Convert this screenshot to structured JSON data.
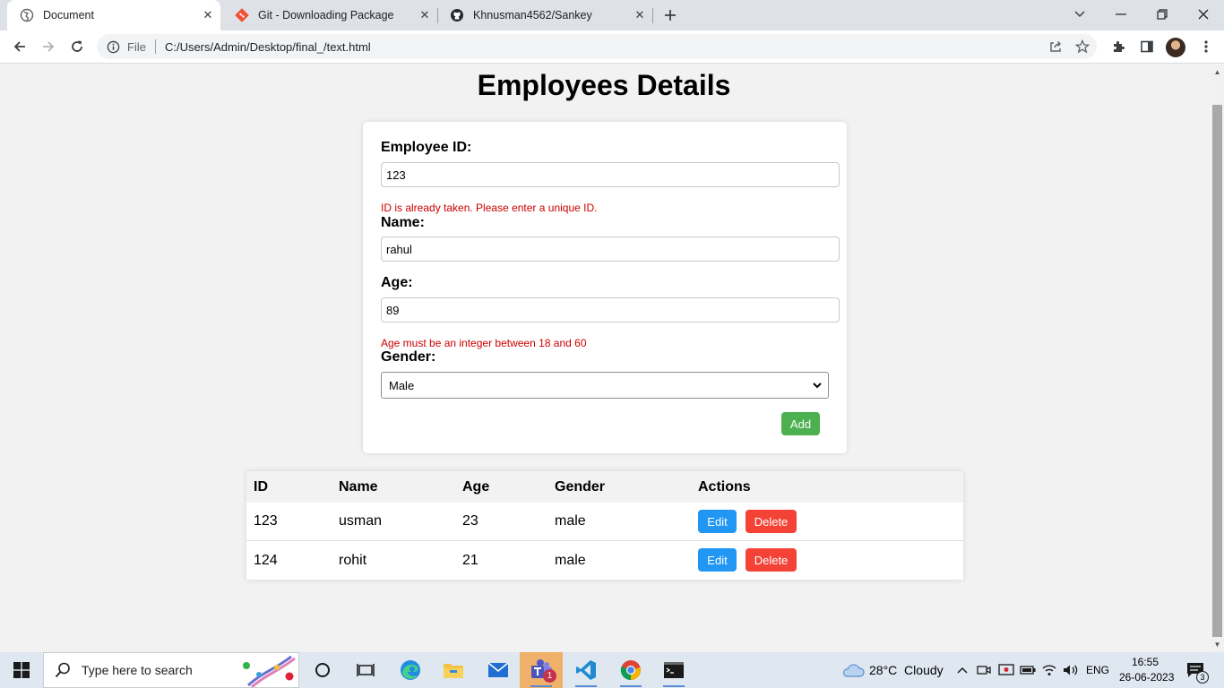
{
  "browser": {
    "tabs": [
      {
        "title": "Document",
        "active": true
      },
      {
        "title": "Git - Downloading Package",
        "active": false
      },
      {
        "title": "Khnusman4562/Sankey",
        "active": false
      }
    ],
    "omnibox": {
      "scheme_label": "File",
      "url": "C:/Users/Admin/Desktop/final_/text.html"
    }
  },
  "page": {
    "title": "Employees Details",
    "form": {
      "id_label": "Employee ID:",
      "id_value": "123",
      "id_error": "ID is already taken. Please enter a unique ID.",
      "name_label": "Name:",
      "name_value": "rahul",
      "age_label": "Age:",
      "age_value": "89",
      "age_error": "Age must be an integer between 18 and 60",
      "gender_label": "Gender:",
      "gender_value": "Male",
      "add_label": "Add"
    },
    "table": {
      "headers": [
        "ID",
        "Name",
        "Age",
        "Gender",
        "Actions"
      ],
      "rows": [
        {
          "id": "123",
          "name": "usman",
          "age": "23",
          "gender": "male"
        },
        {
          "id": "124",
          "name": "rohit",
          "age": "21",
          "gender": "male"
        }
      ],
      "edit_label": "Edit",
      "delete_label": "Delete"
    }
  },
  "taskbar": {
    "search_placeholder": "Type here to search",
    "weather": "28°C  Cloudy",
    "language": "ENG",
    "time": "16:55",
    "date": "26-06-2023",
    "teams_badge": "1",
    "notifications_count": "3"
  },
  "colors": {
    "add": "#4caf50",
    "edit": "#2196f3",
    "delete": "#f44336",
    "error": "#cc0000"
  }
}
